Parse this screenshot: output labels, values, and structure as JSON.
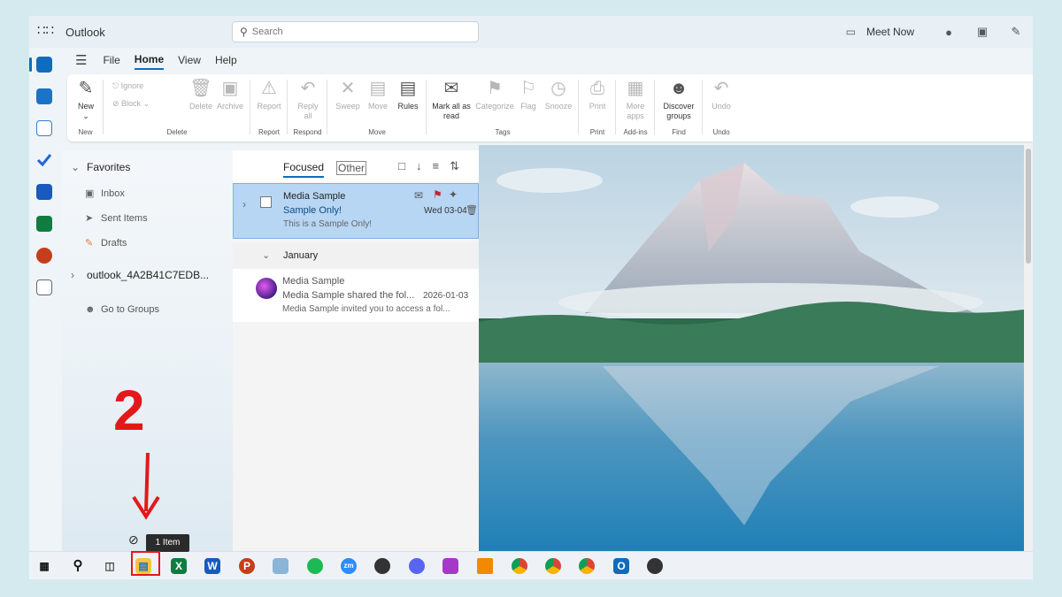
{
  "titlebar": {
    "app_title": "Outlook",
    "search_placeholder": "Search",
    "meet_now": "Meet Now"
  },
  "menu": {
    "items": [
      "File",
      "Home",
      "View",
      "Help"
    ],
    "active": "Home"
  },
  "ribbon": {
    "groups": [
      {
        "name": "New",
        "buttons": [
          "New"
        ]
      },
      {
        "name": "Delete",
        "buttons": [
          "Ignore",
          "Block",
          "Delete",
          "Archive"
        ]
      },
      {
        "name": "Report",
        "buttons": [
          "Report"
        ]
      },
      {
        "name": "Respond",
        "buttons": [
          "Reply all"
        ]
      },
      {
        "name": "Move",
        "buttons": [
          "Sweep",
          "Move",
          "Rules"
        ]
      },
      {
        "name": "Tags",
        "buttons": [
          "Mark all as read",
          "Categorize",
          "Flag",
          "Snooze"
        ]
      },
      {
        "name": "Print",
        "buttons": [
          "Print"
        ]
      },
      {
        "name": "Add-ins",
        "buttons": [
          "More apps"
        ]
      },
      {
        "name": "Find",
        "buttons": [
          "Discover groups"
        ]
      },
      {
        "name": "Undo",
        "buttons": [
          "Undo"
        ]
      }
    ],
    "labels": {
      "new": "New",
      "ignore": "Ignore",
      "block": "Block",
      "delete": "Delete",
      "archive": "Archive",
      "report": "Report",
      "reply_all_1": "Reply",
      "reply_all_2": "all",
      "sweep": "Sweep",
      "move": "Move",
      "rules": "Rules",
      "mark_read_1": "Mark all as",
      "mark_read_2": "read",
      "categorize": "Categorize",
      "flag": "Flag",
      "snooze": "Snooze",
      "print": "Print",
      "more_apps_1": "More",
      "more_apps_2": "apps",
      "discover_1": "Discover",
      "discover_2": "groups",
      "undo": "Undo",
      "g_new": "New",
      "g_delete": "Delete",
      "g_report": "Report",
      "g_respond": "Respond",
      "g_move": "Move",
      "g_tags": "Tags",
      "g_print": "Print",
      "g_addins": "Add-ins",
      "g_find": "Find",
      "g_undo": "Undo"
    }
  },
  "sidebar": {
    "favorites": "Favorites",
    "inbox": "Inbox",
    "sent": "Sent Items",
    "drafts": "Drafts",
    "account": "outlook_4A2B41C7EDB...",
    "groups": "Go to Groups"
  },
  "message_list": {
    "tab_focused": "Focused",
    "tab_other": "Other",
    "messages": [
      {
        "from": "Media Sample",
        "subject": "Sample Only!",
        "preview": "This is a Sample Only!",
        "date": "Wed 03-04",
        "selected": true
      },
      {
        "from": "Media Sample",
        "subject": "Media Sample shared the fol...",
        "preview": "Media Sample invited you to access a fol...",
        "date": "2026-01-03",
        "selected": false
      }
    ],
    "group_header": "January"
  },
  "taskbar": {
    "tooltip": "1 Item"
  },
  "annotation": {
    "step_number": "2",
    "color": "#e3181b"
  }
}
